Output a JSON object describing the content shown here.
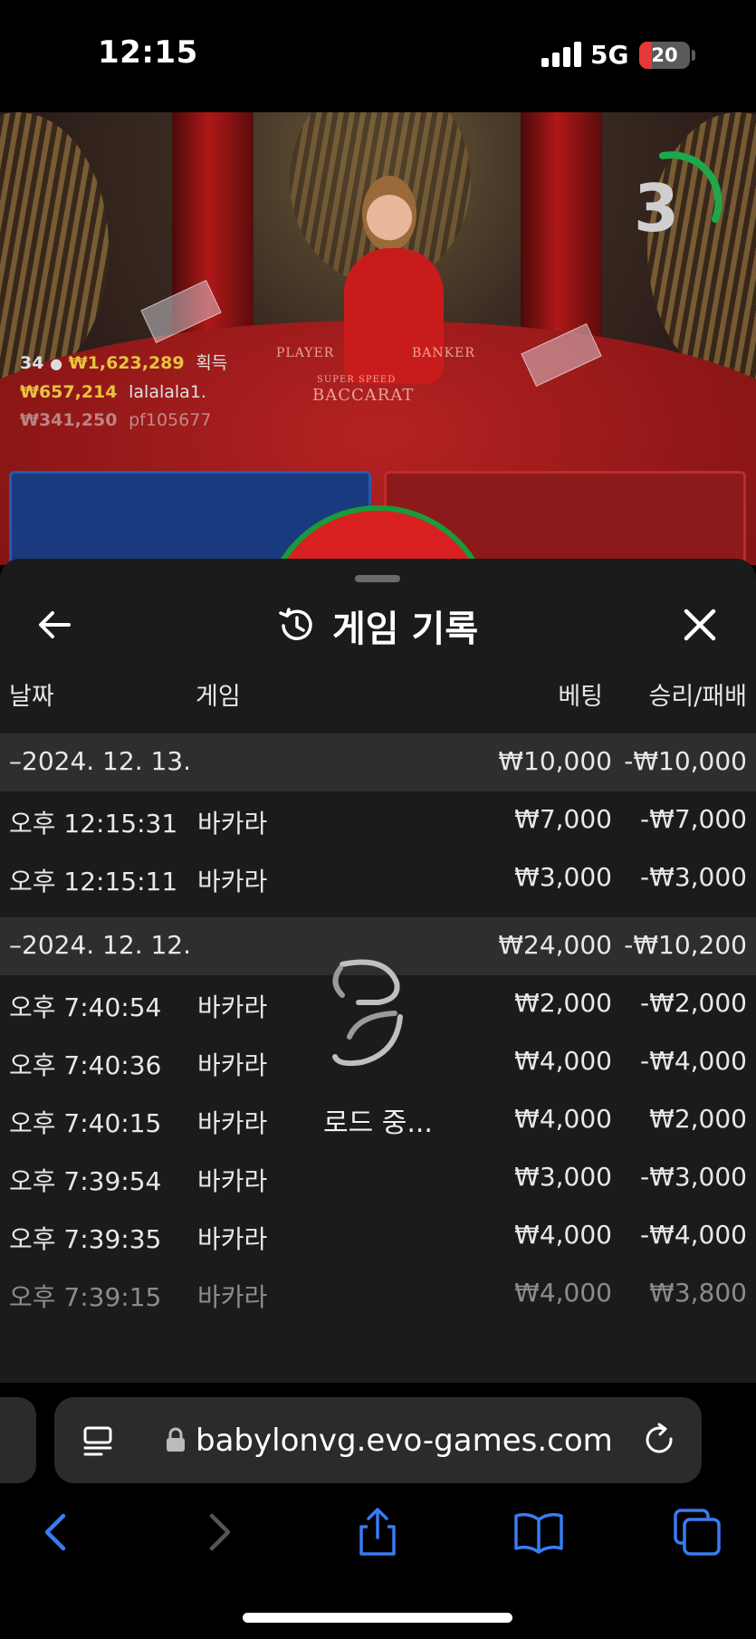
{
  "status_bar": {
    "time": "12:15",
    "network": "5G",
    "battery": "20"
  },
  "video": {
    "timer": "3",
    "felt_labels": [
      "PLAYER",
      "BANKER",
      "SUPER SPEED",
      "BACCARAT"
    ],
    "winners": {
      "count": "34",
      "total": "₩1,623,289",
      "total_suffix": "획득",
      "rows": [
        {
          "amount": "₩657,214",
          "name": "lalalala1."
        },
        {
          "amount": "₩341,250",
          "name": "pf105677"
        }
      ]
    }
  },
  "sheet": {
    "title": "게임 기록",
    "columns": {
      "date": "날짜",
      "game": "게임",
      "bet": "베팅",
      "win": "승리/패배"
    },
    "groups": [
      {
        "date": "–2024. 12. 13.",
        "bet": "₩10,000",
        "win": "-₩10,000",
        "rows": [
          {
            "time": "오후 12:15:31",
            "game": "바카라",
            "bet": "₩7,000",
            "win": "-₩7,000"
          },
          {
            "time": "오후 12:15:11",
            "game": "바카라",
            "bet": "₩3,000",
            "win": "-₩3,000"
          }
        ]
      },
      {
        "date": "–2024. 12. 12.",
        "bet": "₩24,000",
        "win": "-₩10,200",
        "rows": [
          {
            "time": "오후 7:40:54",
            "game": "바카라",
            "bet": "₩2,000",
            "win": "-₩2,000"
          },
          {
            "time": "오후 7:40:36",
            "game": "바카라",
            "bet": "₩4,000",
            "win": "-₩4,000"
          },
          {
            "time": "오후 7:40:15",
            "game": "바카라",
            "bet": "₩4,000",
            "win": "₩2,000"
          },
          {
            "time": "오후 7:39:54",
            "game": "바카라",
            "bet": "₩3,000",
            "win": "-₩3,000"
          },
          {
            "time": "오후 7:39:35",
            "game": "바카라",
            "bet": "₩4,000",
            "win": "-₩4,000"
          },
          {
            "time": "오후 7:39:15",
            "game": "바카라",
            "bet": "₩4,000",
            "win": "₩3,800"
          }
        ]
      }
    ],
    "loading_text": "로드 중..."
  },
  "browser": {
    "url": "babylonvg.evo-games.com",
    "accent": "#3a7bf2"
  },
  "icons": [
    "back-arrow-icon",
    "history-icon",
    "close-icon",
    "reader-icon",
    "lock-icon",
    "reload-icon",
    "back-icon",
    "forward-icon",
    "share-icon",
    "bookmarks-icon",
    "tabs-icon"
  ]
}
